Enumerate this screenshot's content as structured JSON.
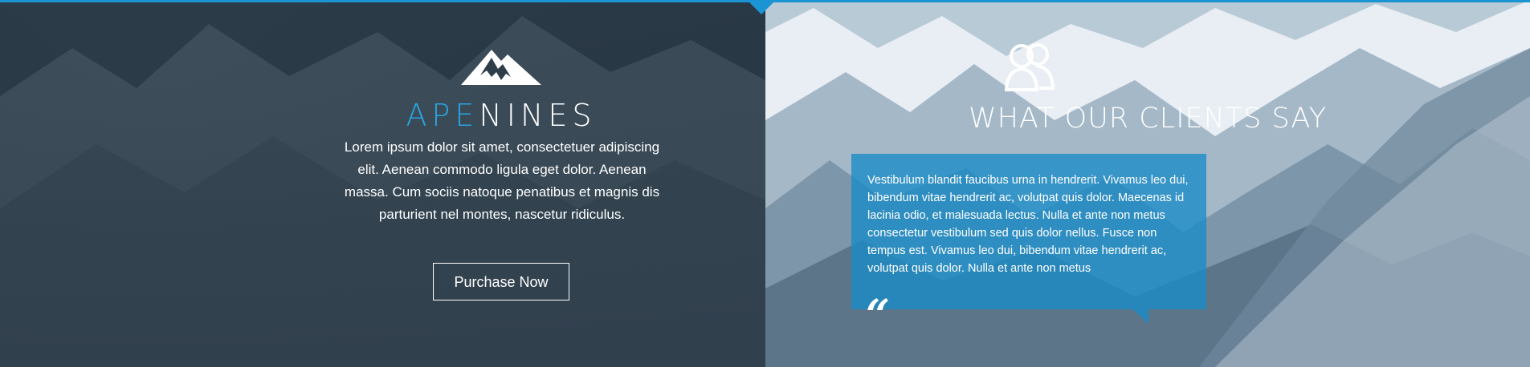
{
  "brand": {
    "name_accent": "APE",
    "name_rest": "NINES",
    "logo_icon": "mountain-icon",
    "intro": "Lorem ipsum dolor sit amet, consectetuer adipiscing elit. Aenean commodo ligula eget dolor. Aenean massa. Cum sociis natoque penatibus et magnis dis parturient nel montes, nascetur ridiculus.",
    "cta_label": "Purchase Now"
  },
  "testimonials": {
    "icon": "people-icon",
    "title": "WHAT OUR CLIENTS SAY",
    "quote": "Vestibulum blandit faucibus urna in hendrerit. Vivamus leo dui, bibendum vitae hendrerit ac, volutpat quis dolor. Maecenas id lacinia odio, et malesuada lectus. Nulla et ante non metus consectetur vestibulum sed quis dolor nellus. Fusce non tempus est. Vivamus leo dui, bibendum vitae hendrerit ac, volutpat quis dolor. Nulla et ante non metus",
    "quote_mark": "“"
  },
  "colors": {
    "accent": "#1a94d2",
    "left_bg": "#2d3d49",
    "quote_bg": "#188cc8"
  }
}
